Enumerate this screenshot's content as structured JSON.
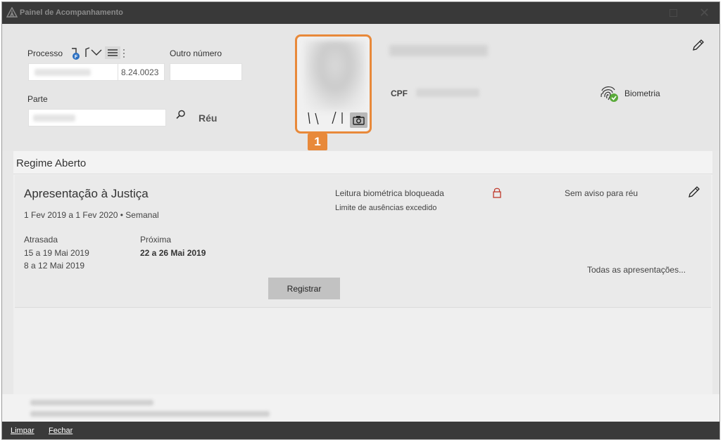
{
  "window": {
    "title": "Painel de Acompanhamento"
  },
  "header": {
    "processo_label": "Processo",
    "processo_number_suffix": "8.24.0023",
    "outro_numero_label": "Outro número",
    "parte_label": "Parte",
    "reu_label": "Réu",
    "cpf_label": "CPF",
    "biometria_label": "Biometria",
    "photo_badge": "1"
  },
  "regime": {
    "title": "Regime Aberto",
    "card": {
      "title": "Apresentação à Justiça",
      "period": "1 Fev 2019 a 1 Fev 2020 • Semanal",
      "atrasada_label": "Atrasada",
      "atrasadas": [
        "15 a 19 Mai 2019",
        "8 a 12 Mai 2019"
      ],
      "proxima_label": "Próxima",
      "proxima_value": "22 a 26 Mai 2019",
      "leitura_status": "Leitura biométrica bloqueada",
      "limite_status": "Limite de ausências excedido",
      "aviso": "Sem aviso para réu",
      "todas_link": "Todas as apresentações...",
      "registrar_label": "Registrar"
    }
  },
  "footer": {
    "limpar_label": "Limpar",
    "fechar_label": "Fechar"
  },
  "colors": {
    "accent": "#e8893a",
    "titlebar": "#393939",
    "lock": "#c0392b",
    "bio_check": "#5aaa3a"
  }
}
